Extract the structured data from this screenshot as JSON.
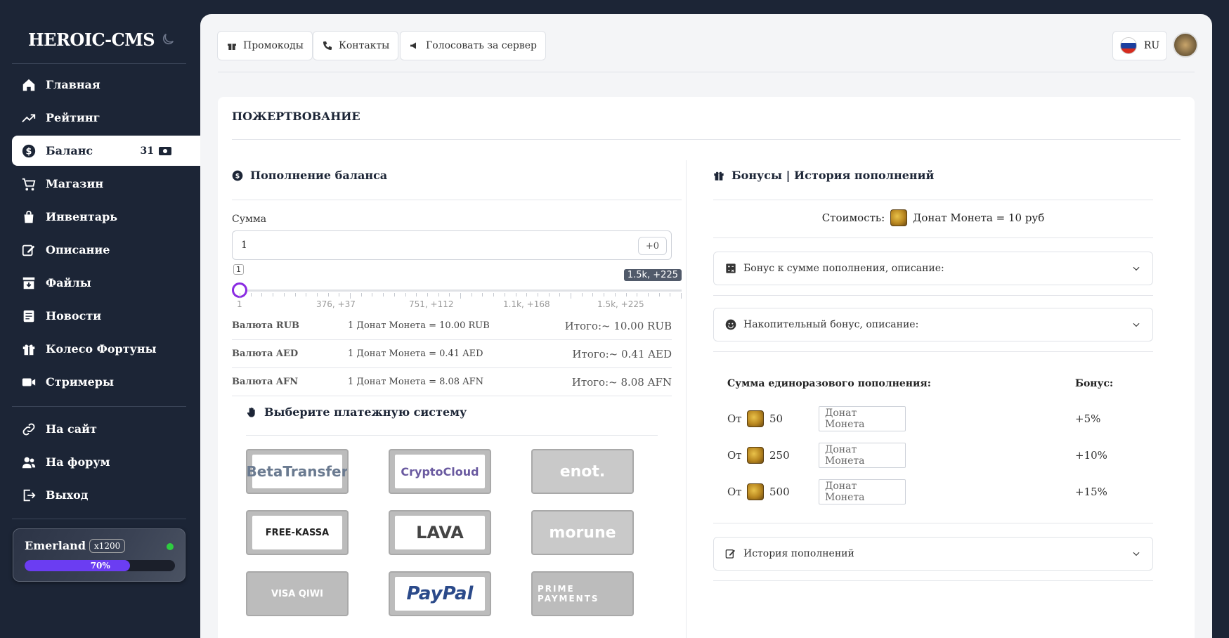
{
  "app": {
    "logo": "HEROIC-CMS"
  },
  "sidebar": {
    "items": [
      {
        "label": "Главная",
        "icon": "home-icon"
      },
      {
        "label": "Рейтинг",
        "icon": "trending-up-icon"
      },
      {
        "label": "Баланс",
        "icon": "dollar-icon",
        "count": "31"
      },
      {
        "label": "Магазин",
        "icon": "cart-icon"
      },
      {
        "label": "Инвентарь",
        "icon": "bag-icon"
      },
      {
        "label": "Описание",
        "icon": "edit-icon"
      },
      {
        "label": "Файлы",
        "icon": "download-box-icon"
      },
      {
        "label": "Новости",
        "icon": "newspaper-icon"
      },
      {
        "label": "Колесо Фортуны",
        "icon": "gift-icon"
      },
      {
        "label": "Стримеры",
        "icon": "video-icon"
      },
      {
        "label": "На сайт",
        "icon": "link-icon"
      },
      {
        "label": "На форум",
        "icon": "users-icon"
      },
      {
        "label": "Выход",
        "icon": "logout-icon"
      }
    ],
    "server": {
      "name": "Emerland",
      "rate": "x1200",
      "progress_label": "70%",
      "progress": 0.7
    }
  },
  "topbar": {
    "buttons": [
      {
        "label": "Промокоды"
      },
      {
        "label": "Контакты"
      },
      {
        "label": "Голосовать за сервер"
      }
    ],
    "lang": "RU"
  },
  "page": {
    "title": "ПОЖЕРТВОВАНИЕ"
  },
  "balance": {
    "title": "Пополнение баланса",
    "sum_label": "Сумма",
    "sum_value": "1",
    "sum_bonus": "+0",
    "range_tip": "1",
    "range_max_tip": "1.5k, +225",
    "ticks": [
      "1",
      "376, +37",
      "751, +112",
      "1.1k, +168",
      "1.5k, +225"
    ],
    "currencies": [
      {
        "name": "Валюта RUB",
        "rate": "1 Донат Монета = 10.00 RUB",
        "total": "Итого:~ 10.00 RUB"
      },
      {
        "name": "Валюта AED",
        "rate": "1 Донат Монета = 0.41 AED",
        "total": "Итого:~ 0.41 AED"
      },
      {
        "name": "Валюта AFN",
        "rate": "1 Донат Монета = 8.08 AFN",
        "total": "Итого:~ 8.08 AFN"
      }
    ],
    "pay_title": "Выберите платежную систему",
    "payments": [
      "BetaTransfer",
      "CryptoCloud",
      "enot.",
      "FREE-KASSA",
      "LAVA",
      "morune",
      "VISA QIWI",
      "PayPal",
      "PRIME PAYMENTS"
    ]
  },
  "bonuses": {
    "title": "Бонусы | История пополнений",
    "price_prefix": "Стоимость:",
    "price_text": "Донат Монета = 10 руб",
    "acc1": "Бонус к сумме пополнения, описание:",
    "acc2": "Накопительный бонус, описание:",
    "head_sum": "Сумма единоразового пополнения:",
    "head_bonus": "Бонус:",
    "rows": [
      {
        "from": "От",
        "amount": "50",
        "tag": "Донат Монета",
        "pct": "+5%"
      },
      {
        "from": "От",
        "amount": "250",
        "tag": "Донат Монета",
        "pct": "+10%"
      },
      {
        "from": "От",
        "amount": "500",
        "tag": "Донат Монета",
        "pct": "+15%"
      }
    ],
    "history": "История пополнений"
  }
}
